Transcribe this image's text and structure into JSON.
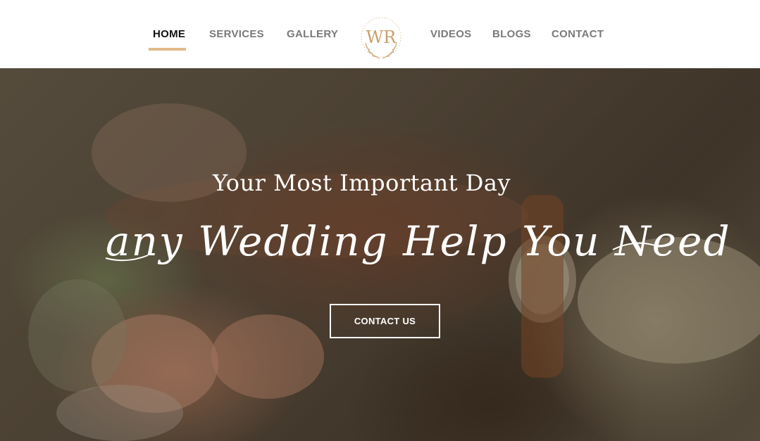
{
  "nav": {
    "left_items": [
      {
        "label": "HOME",
        "active": true
      },
      {
        "label": "SERVICES",
        "active": false
      },
      {
        "label": "GALLERY",
        "active": false
      }
    ],
    "right_items": [
      {
        "label": "VIDEOS",
        "active": false
      },
      {
        "label": "BLOGS",
        "active": false
      },
      {
        "label": "CONTACT",
        "active": false
      }
    ],
    "logo_monogram": "WR",
    "accent_color": "#e3b98b"
  },
  "hero": {
    "subtitle": "Your Most Important Day",
    "title": "any Wedding Help You Need",
    "cta_label": "CONTACT US"
  }
}
